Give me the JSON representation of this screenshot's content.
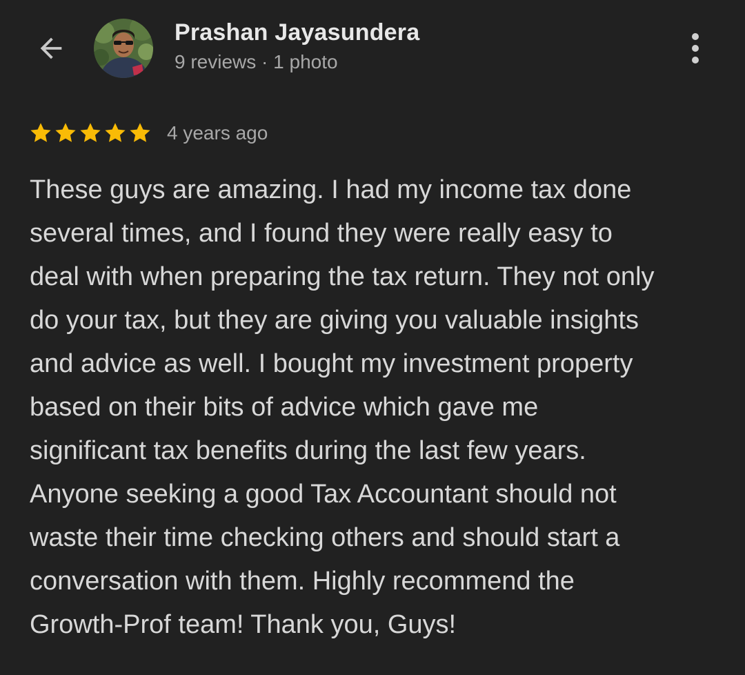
{
  "header": {
    "back_icon": "arrow-left-icon",
    "avatar_icon": "profile-photo",
    "reviewer_name": "Prashan Jayasundera",
    "reviewer_meta": "9 reviews · 1 photo",
    "more_icon": "more-vert-icon"
  },
  "review": {
    "rating": 5,
    "rating_max": 5,
    "star_color": "#f9bb06",
    "time_ago": "4 years ago",
    "text_lines": [
      "These guys are amazing. I had my income tax done",
      "several times, and I found they were really easy to",
      "deal with when preparing the tax return. They not only",
      "do your tax, but they are giving you valuable insights",
      "and advice as well. I bought my investment property",
      "based on their bits of advice which gave me",
      "significant tax benefits during the last few years.",
      "Anyone seeking a good Tax Accountant should not",
      "waste their time checking others and should start a",
      "conversation with them. Highly recommend the",
      "Growth-Prof team! Thank you, Guys!"
    ]
  },
  "colors": {
    "background": "#212121",
    "primary_text": "#d8d8d8",
    "secondary_text": "#a8a8a8"
  }
}
